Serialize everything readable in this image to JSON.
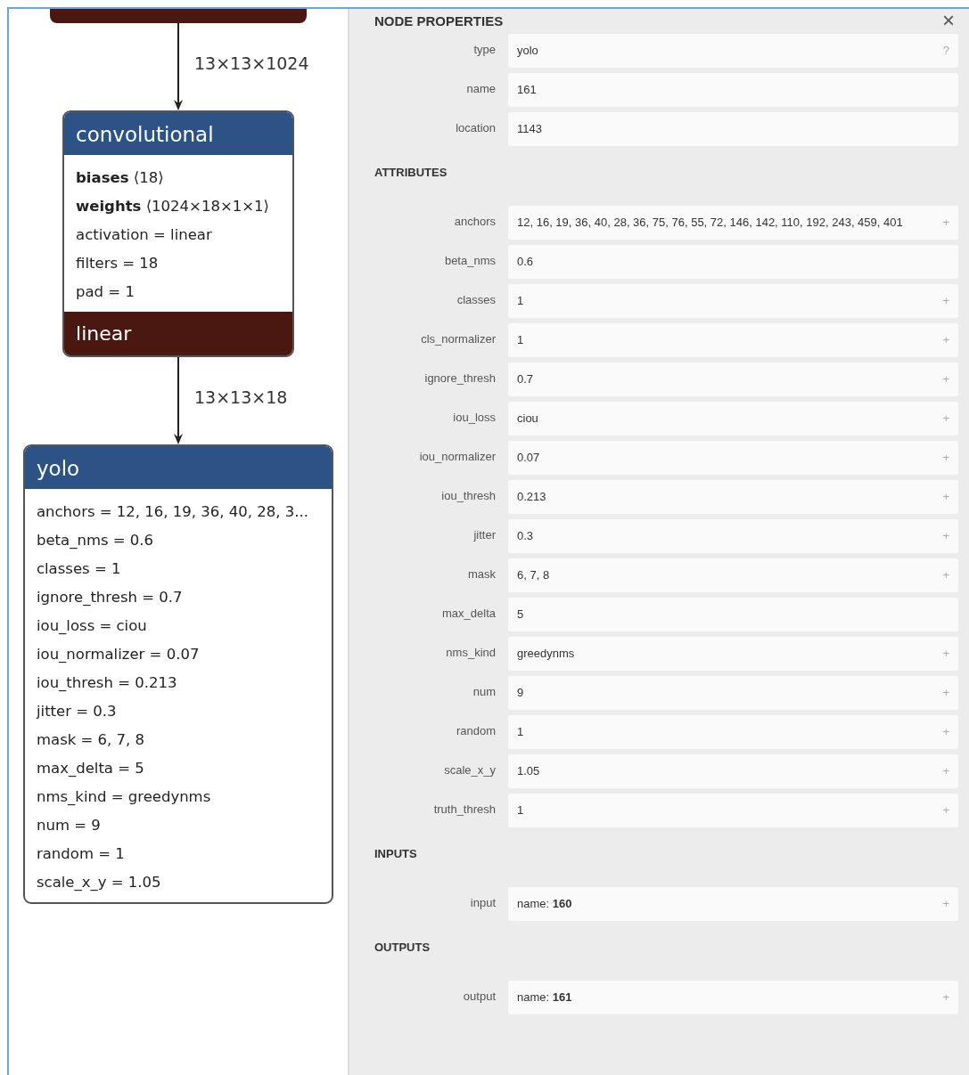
{
  "graph": {
    "items": [
      {
        "kind": "fragment"
      },
      {
        "kind": "edge",
        "label": "13×13×1024"
      },
      {
        "kind": "node",
        "title": "convolutional",
        "lines": [
          "**biases** ⟨18⟩",
          "**weights** ⟨1024×18×1×1⟩",
          "activation = linear",
          "filters = 18",
          "pad = 1"
        ],
        "footer": "linear"
      },
      {
        "kind": "edge",
        "label": "13×13×18"
      },
      {
        "kind": "node",
        "title": "yolo",
        "lines": [
          "anchors = 12, 16, 19, 36, 40, 28, 3...",
          "beta_nms = 0.6",
          "classes = 1",
          "ignore_thresh = 0.7",
          "iou_loss = ciou",
          "iou_normalizer = 0.07",
          "iou_thresh = 0.213",
          "jitter = 0.3",
          "mask = 6, 7, 8",
          "max_delta = 5",
          "nms_kind = greedynms",
          "num = 9",
          "random = 1",
          "scale_x_y = 1.05"
        ]
      }
    ]
  },
  "properties": {
    "title": "NODE PROPERTIES",
    "close": "×",
    "sections": [
      {
        "rows": [
          {
            "label": "type",
            "value": "yolo",
            "button": "?"
          },
          {
            "label": "name",
            "value": "161"
          },
          {
            "label": "location",
            "value": "1143"
          }
        ]
      },
      {
        "title": "ATTRIBUTES",
        "rows": [
          {
            "label": "anchors",
            "value": "12, 16, 19, 36, 40, 28, 36, 75, 76, 55, 72, 146, 142, 110, 192, 243, 459, 401",
            "button": "+"
          },
          {
            "label": "beta_nms",
            "value": "0.6"
          },
          {
            "label": "classes",
            "value": "1",
            "button": "+"
          },
          {
            "label": "cls_normalizer",
            "value": "1",
            "button": "+"
          },
          {
            "label": "ignore_thresh",
            "value": "0.7",
            "button": "+"
          },
          {
            "label": "iou_loss",
            "value": "ciou",
            "button": "+"
          },
          {
            "label": "iou_normalizer",
            "value": "0.07",
            "button": "+"
          },
          {
            "label": "iou_thresh",
            "value": "0.213",
            "button": "+"
          },
          {
            "label": "jitter",
            "value": "0.3",
            "button": "+"
          },
          {
            "label": "mask",
            "value": "6, 7, 8",
            "button": "+"
          },
          {
            "label": "max_delta",
            "value": "5"
          },
          {
            "label": "nms_kind",
            "value": "greedynms",
            "button": "+"
          },
          {
            "label": "num",
            "value": "9",
            "button": "+"
          },
          {
            "label": "random",
            "value": "1",
            "button": "+"
          },
          {
            "label": "scale_x_y",
            "value": "1.05",
            "button": "+"
          },
          {
            "label": "truth_thresh",
            "value": "1",
            "button": "+"
          }
        ]
      },
      {
        "title": "INPUTS",
        "rows": [
          {
            "label": "input",
            "value": "name: **160**",
            "button": "+"
          }
        ]
      },
      {
        "title": "OUTPUTS",
        "rows": [
          {
            "label": "output",
            "value": "name: **161**",
            "button": "+"
          }
        ]
      }
    ]
  }
}
